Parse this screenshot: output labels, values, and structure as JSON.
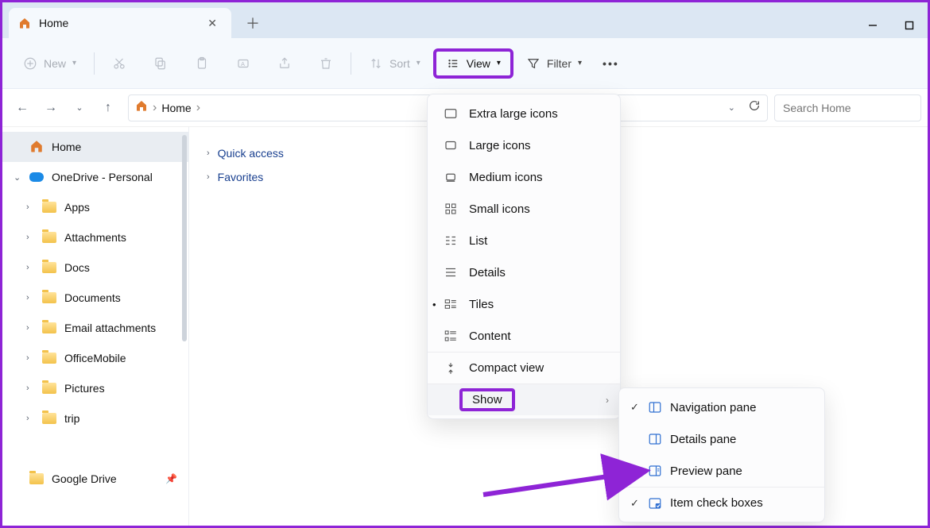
{
  "tab": {
    "title": "Home"
  },
  "toolbar": {
    "new_label": "New",
    "sort_label": "Sort",
    "view_label": "View",
    "filter_label": "Filter"
  },
  "breadcrumb": {
    "root": "Home"
  },
  "search": {
    "placeholder": "Search Home"
  },
  "sidebar": {
    "home": "Home",
    "onedrive": "OneDrive - Personal",
    "items": [
      "Apps",
      "Attachments",
      "Docs",
      "Documents",
      "Email attachments",
      "OfficeMobile",
      "Pictures",
      "trip"
    ],
    "gdrive": "Google Drive"
  },
  "content": {
    "quick_access": "Quick access",
    "favorites": "Favorites"
  },
  "view_menu": {
    "extra_large": "Extra large icons",
    "large": "Large icons",
    "medium": "Medium icons",
    "small": "Small icons",
    "list": "List",
    "details": "Details",
    "tiles": "Tiles",
    "content": "Content",
    "compact": "Compact view",
    "show": "Show"
  },
  "show_menu": {
    "nav_pane": "Navigation pane",
    "details_pane": "Details pane",
    "preview_pane": "Preview pane",
    "item_checks": "Item check boxes"
  }
}
